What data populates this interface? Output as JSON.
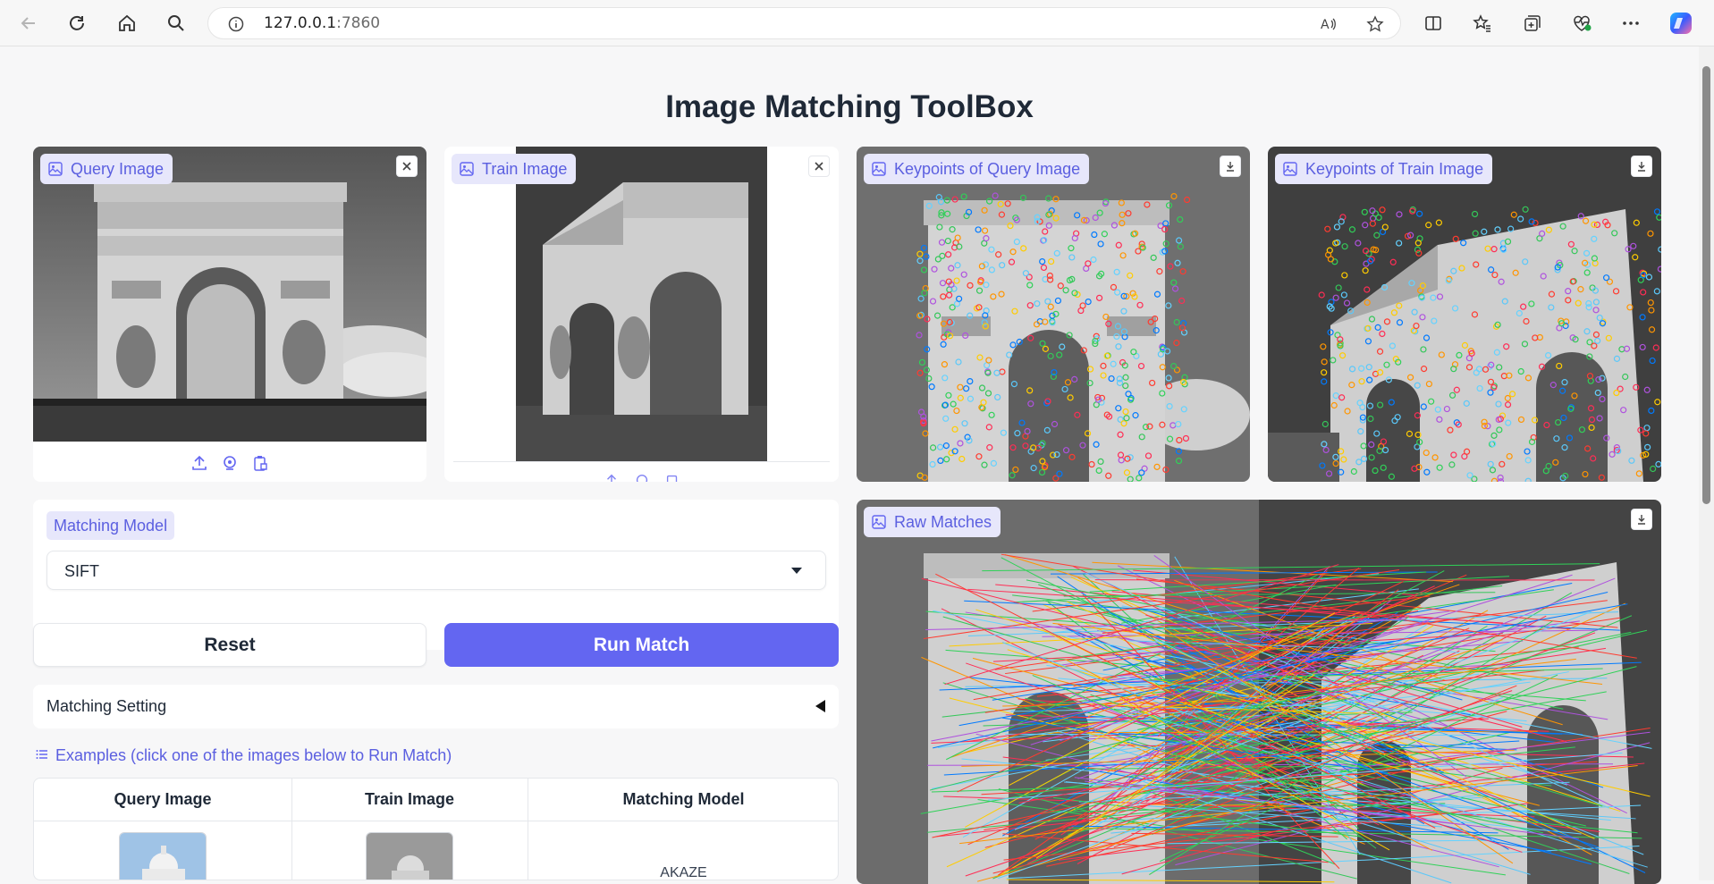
{
  "browser": {
    "url_host": "127.0.0.1",
    "url_port": ":7860"
  },
  "page": {
    "title": "Image Matching ToolBox"
  },
  "query_panel": {
    "label": "Query Image"
  },
  "train_panel": {
    "label": "Train Image"
  },
  "kp_query_panel": {
    "label": "Keypoints of Query Image"
  },
  "kp_train_panel": {
    "label": "Keypoints of Train Image"
  },
  "raw_matches_panel": {
    "label": "Raw Matches"
  },
  "matching_model": {
    "label": "Matching Model",
    "selected": "SIFT"
  },
  "buttons": {
    "reset": "Reset",
    "run": "Run Match"
  },
  "settings": {
    "label": "Matching Setting"
  },
  "examples": {
    "heading": "Examples (click one of the images below to Run Match)",
    "columns": [
      "Query Image",
      "Train Image",
      "Matching Model"
    ],
    "rows": [
      {
        "model": "AKAZE"
      }
    ]
  },
  "colors": {
    "accent": "#6366f1",
    "chip_bg": "#e7e7fb",
    "chip_text": "#5b5fe0"
  },
  "icons": [
    "back-icon",
    "refresh-icon",
    "home-icon",
    "search-icon",
    "info-icon",
    "read-aloud-icon",
    "favorite-star-icon",
    "split-screen-icon",
    "favorites-icon",
    "collections-icon",
    "performance-icon",
    "more-icon",
    "copilot-icon",
    "image-icon",
    "close-icon",
    "download-icon",
    "upload-icon",
    "webcam-icon",
    "clipboard-icon",
    "list-icon"
  ]
}
